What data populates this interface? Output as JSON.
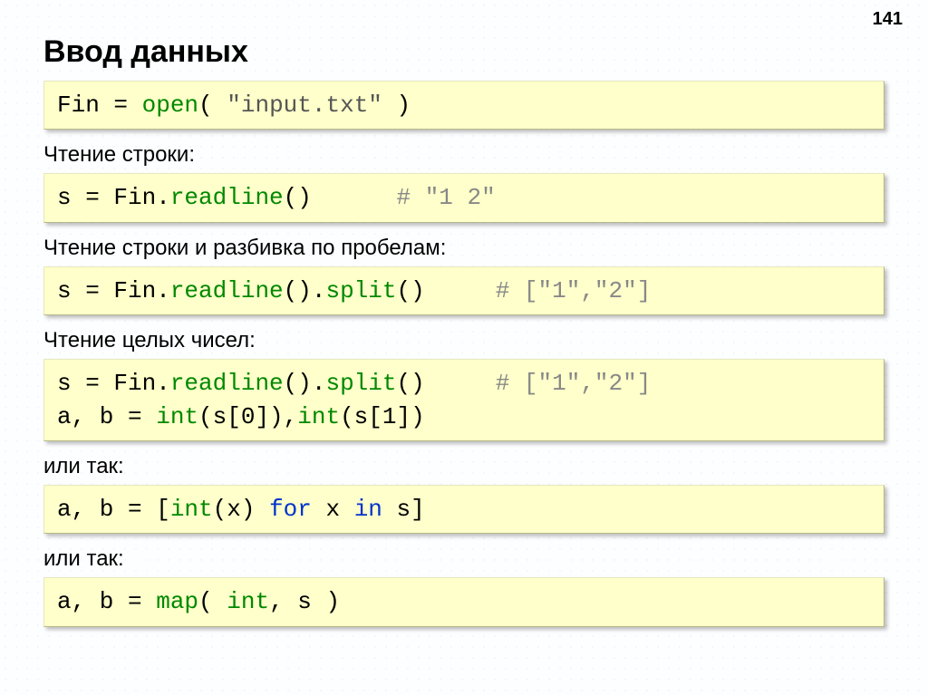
{
  "page_number": "141",
  "title": "Ввод данных",
  "blocks": [
    {
      "type": "code",
      "tokens": [
        {
          "cls": "c-text",
          "t": "Fin = "
        },
        {
          "cls": "c-func",
          "t": "open"
        },
        {
          "cls": "c-text",
          "t": "( "
        },
        {
          "cls": "c-str",
          "t": "\"input.txt\""
        },
        {
          "cls": "c-text",
          "t": " )"
        }
      ]
    },
    {
      "type": "label",
      "text": "Чтение строки:"
    },
    {
      "type": "code",
      "tokens": [
        {
          "cls": "c-text",
          "t": "s = Fin."
        },
        {
          "cls": "c-func",
          "t": "readline"
        },
        {
          "cls": "c-text",
          "t": "()      "
        },
        {
          "cls": "c-comment",
          "t": "# \"1 2\""
        }
      ]
    },
    {
      "type": "label",
      "text": "Чтение строки и разбивка по пробелам:"
    },
    {
      "type": "code",
      "tokens": [
        {
          "cls": "c-text",
          "t": "s = Fin."
        },
        {
          "cls": "c-func",
          "t": "readline"
        },
        {
          "cls": "c-text",
          "t": "()."
        },
        {
          "cls": "c-func",
          "t": "split"
        },
        {
          "cls": "c-text",
          "t": "()     "
        },
        {
          "cls": "c-comment",
          "t": "# [\"1\",\"2\"]"
        }
      ]
    },
    {
      "type": "label",
      "text": "Чтение целых чисел:"
    },
    {
      "type": "code",
      "tokens": [
        {
          "cls": "c-text",
          "t": "s = Fin."
        },
        {
          "cls": "c-func",
          "t": "readline"
        },
        {
          "cls": "c-text",
          "t": "()."
        },
        {
          "cls": "c-func",
          "t": "split"
        },
        {
          "cls": "c-text",
          "t": "()     "
        },
        {
          "cls": "c-comment",
          "t": "# [\"1\",\"2\"]"
        },
        {
          "cls": "c-text",
          "t": "\na, b = "
        },
        {
          "cls": "c-func",
          "t": "int"
        },
        {
          "cls": "c-text",
          "t": "(s[0]),"
        },
        {
          "cls": "c-func",
          "t": "int"
        },
        {
          "cls": "c-text",
          "t": "(s[1])"
        }
      ]
    },
    {
      "type": "label",
      "text": "или так:"
    },
    {
      "type": "code",
      "tokens": [
        {
          "cls": "c-text",
          "t": "a, b = ["
        },
        {
          "cls": "c-func",
          "t": "int"
        },
        {
          "cls": "c-text",
          "t": "(x) "
        },
        {
          "cls": "c-blue",
          "t": "for"
        },
        {
          "cls": "c-text",
          "t": " x "
        },
        {
          "cls": "c-blue",
          "t": "in"
        },
        {
          "cls": "c-text",
          "t": " s]"
        }
      ]
    },
    {
      "type": "label",
      "text": "или так:"
    },
    {
      "type": "code",
      "tokens": [
        {
          "cls": "c-text",
          "t": "a, b = "
        },
        {
          "cls": "c-func",
          "t": "map"
        },
        {
          "cls": "c-text",
          "t": "( "
        },
        {
          "cls": "c-func",
          "t": "int"
        },
        {
          "cls": "c-text",
          "t": ", s )"
        }
      ]
    }
  ]
}
